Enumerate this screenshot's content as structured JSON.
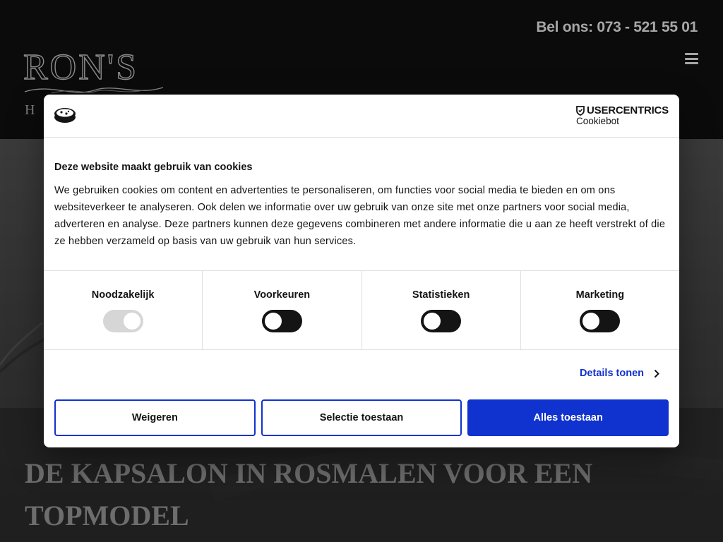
{
  "header": {
    "phone_label": "Bel ons: 073 - 521 55 01",
    "logo_text": "RON'S",
    "logo_subtext": "H",
    "menu_icon": "hamburger-icon"
  },
  "hero": {
    "title": "De kapsalon in Rosmalen voor een topmodel"
  },
  "cookie_dialog": {
    "brand_name": "USERCENTRICS",
    "brand_sub": "Cookiebot",
    "title": "Deze website maakt gebruik van cookies",
    "description": "We gebruiken cookies om content en advertenties te personaliseren, om functies voor social media te bieden en om ons websiteverkeer te analyseren. Ook delen we informatie over uw gebruik van onze site met onze partners voor social media, adverteren en analyse. Deze partners kunnen deze gegevens combineren met andere informatie die u aan ze heeft verstrekt of die ze hebben verzameld op basis van uw gebruik van hun services.",
    "toggles": [
      {
        "label": "Noodzakelijk",
        "state": "on-disabled"
      },
      {
        "label": "Voorkeuren",
        "state": "off"
      },
      {
        "label": "Statistieken",
        "state": "off"
      },
      {
        "label": "Marketing",
        "state": "off"
      }
    ],
    "details_label": "Details tonen",
    "buttons": {
      "reject": "Weigeren",
      "allow_selection": "Selectie toestaan",
      "allow_all": "Alles toestaan"
    },
    "colors": {
      "accent": "#1032cf",
      "toggle_off": "#141414",
      "toggle_disabled": "#d6d6d6"
    }
  }
}
